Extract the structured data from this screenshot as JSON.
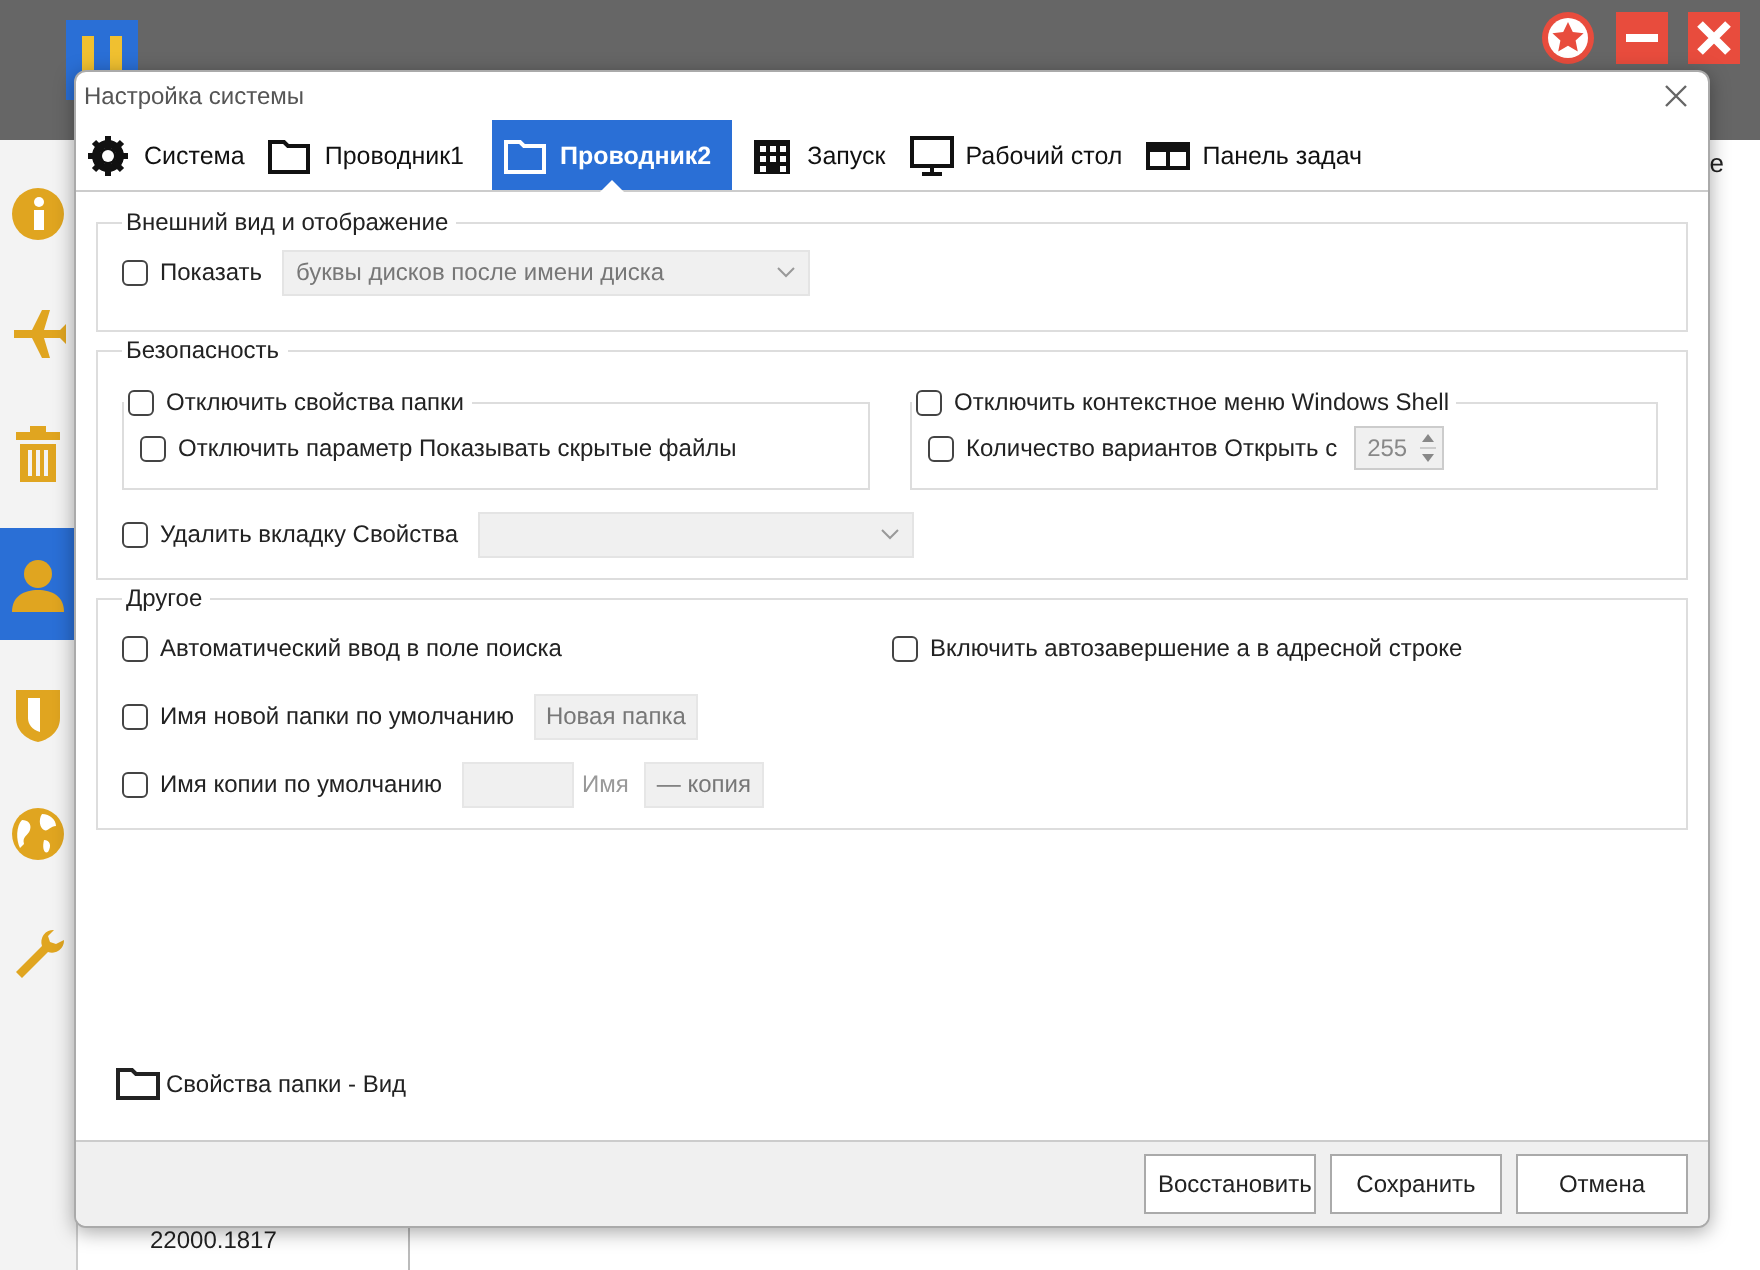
{
  "background": {
    "header_fragment": "e",
    "version": "22000.1817",
    "sidebar": [
      {
        "kind": "info",
        "selected": false
      },
      {
        "kind": "plane",
        "selected": false
      },
      {
        "kind": "trash",
        "selected": false
      },
      {
        "kind": "user",
        "selected": true
      },
      {
        "kind": "shield",
        "selected": false
      },
      {
        "kind": "globe",
        "selected": false
      },
      {
        "kind": "wrench",
        "selected": false
      }
    ]
  },
  "dialog": {
    "title": "Настройка системы",
    "tabs": [
      {
        "label": "Система",
        "kind": "gear",
        "selected": false
      },
      {
        "label": "Проводник1",
        "kind": "folder",
        "selected": false
      },
      {
        "label": "Проводник2",
        "kind": "folder",
        "selected": true
      },
      {
        "label": "Запуск",
        "kind": "grid",
        "selected": false
      },
      {
        "label": "Рабочий стол",
        "kind": "monitor",
        "selected": false
      },
      {
        "label": "Панель задач",
        "kind": "taskbar",
        "selected": false
      }
    ],
    "sections": [
      {
        "title": "Внешний вид и отображение",
        "rows": [
          [
            {
              "label": "Показать",
              "checked": false,
              "extras": [
                {
                  "kind": "combo",
                  "value": "буквы дисков после имени диска"
                }
              ]
            }
          ]
        ]
      },
      {
        "title": "Безопасность",
        "subgroups": [
          {
            "label": "Отключить свойства папки",
            "checked": false,
            "items": [
              {
                "label": "Отключить параметр Показывать скрытые файлы",
                "checked": false
              }
            ]
          },
          {
            "label": "Отключить контекстное меню Windows Shell",
            "checked": false,
            "items": [
              {
                "label": "Количество вариантов Открыть с",
                "checked": false,
                "extras": [
                  {
                    "kind": "spin",
                    "value": "255"
                  }
                ]
              }
            ]
          }
        ],
        "rows": [
          [
            {
              "label": "Удалить вкладку Свойства",
              "checked": false,
              "extras": [
                {
                  "kind": "combo"
                }
              ]
            }
          ]
        ]
      },
      {
        "title": "Другое",
        "rows": [
          [
            {
              "label": "Автоматический ввод в поле поиска",
              "checked": false
            },
            {
              "label": "Включить автозавершение а в адресной строке",
              "checked": false
            }
          ],
          [
            {
              "label": "Имя новой папки по умолчанию",
              "checked": false,
              "extras": [
                {
                  "kind": "input",
                  "value": "Новая папка"
                }
              ]
            }
          ],
          [
            {
              "label": "Имя копии по умолчанию",
              "checked": false,
              "extras": [
                {
                  "kind": "input"
                },
                {
                  "kind": "caption",
                  "text": "Имя"
                },
                {
                  "kind": "input",
                  "value": "— копия"
                }
              ]
            }
          ]
        ]
      }
    ],
    "footer_link": "Свойства папки - Вид",
    "buttons": [
      "Восстановить",
      "Сохранить",
      "Отмена"
    ]
  }
}
